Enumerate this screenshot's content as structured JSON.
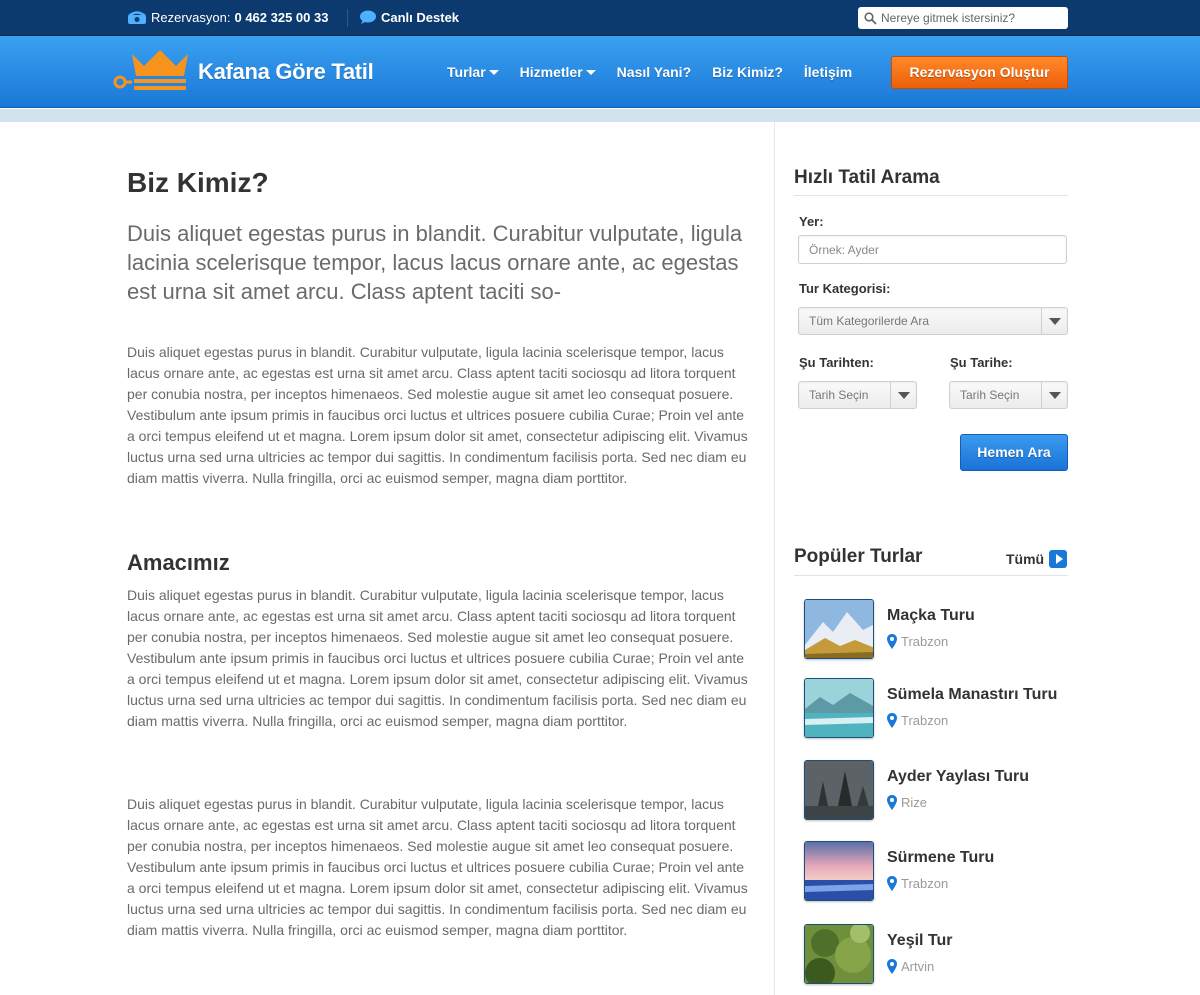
{
  "topbar": {
    "phone_label": "Rezervasyon:",
    "phone_number": "0 462 325 00 33",
    "support_label": "Canlı Destek",
    "search_placeholder": "Nereye gitmek istersiniz?"
  },
  "header": {
    "logo_text": "Kafana Göre Tatil",
    "nav": [
      {
        "label": "Turlar",
        "dropdown": true
      },
      {
        "label": "Hizmetler",
        "dropdown": true
      },
      {
        "label": "Nasıl Yani?",
        "dropdown": false
      },
      {
        "label": "Biz Kimiz?",
        "dropdown": false
      },
      {
        "label": "İletişim",
        "dropdown": false
      }
    ],
    "cta_label": "Rezervasyon Oluştur"
  },
  "main": {
    "title": "Biz Kimiz?",
    "lead": "Duis aliquet egestas purus in blandit. Curabitur vulputate, ligula lacinia scelerisque tempor, lacus lacus ornare ante, ac egestas est urna sit amet arcu. Class aptent taciti so-",
    "para1": "Duis aliquet egestas purus in blandit. Curabitur vulputate, ligula lacinia scelerisque tempor, lacus lacus ornare ante, ac egestas est urna sit amet arcu. Class aptent taciti sociosqu ad litora torquent per conubia nostra, per inceptos himenaeos. Sed molestie augue sit amet leo consequat posuere. Vestibulum ante ipsum primis in faucibus orci luctus et ultrices posuere cubilia Curae; Proin vel ante a orci tempus eleifend ut et magna. Lorem ipsum dolor sit amet, consectetur adipiscing elit. Vivamus luctus urna sed urna ultricies ac tempor dui sagittis. In condimentum facilisis porta. Sed nec diam eu diam mattis viverra. Nulla fringilla, orci ac euismod semper, magna diam porttitor.",
    "section_title": "Amacımız",
    "para2": "Duis aliquet egestas purus in blandit. Curabitur vulputate, ligula lacinia scelerisque tempor, lacus lacus ornare ante, ac egestas est urna sit amet arcu. Class aptent taciti sociosqu ad litora torquent per conubia nostra, per inceptos himenaeos. Sed molestie augue sit amet leo consequat posuere. Vestibulum ante ipsum primis in faucibus orci luctus et ultrices posuere cubilia Curae; Proin vel ante a orci tempus eleifend ut et magna. Lorem ipsum dolor sit amet, consectetur adipiscing elit. Vivamus luctus urna sed urna ultricies ac tempor dui sagittis. In condimentum facilisis porta. Sed nec diam eu diam mattis viverra. Nulla fringilla, orci ac euismod semper, magna diam porttitor.",
    "para3": "Duis aliquet egestas purus in blandit. Curabitur vulputate, ligula lacinia scelerisque tempor, lacus lacus ornare ante, ac egestas est urna sit amet arcu. Class aptent taciti sociosqu ad litora torquent per conubia nostra, per inceptos himenaeos. Sed molestie augue sit amet leo consequat posuere. Vestibulum ante ipsum primis in faucibus orci luctus et ultrices posuere cubilia Curae; Proin vel ante a orci tempus eleifend ut et magna. Lorem ipsum dolor sit amet, consectetur adipiscing elit. Vivamus luctus urna sed urna ultricies ac tempor dui sagittis. In condimentum facilisis porta. Sed nec diam eu diam mattis viverra. Nulla fringilla, orci ac euismod semper, magna diam porttitor."
  },
  "search_form": {
    "title": "Hızlı Tatil Arama",
    "place_label": "Yer:",
    "place_placeholder": "Örnek: Ayder",
    "category_label": "Tur Kategorisi:",
    "category_value": "Tüm Kategorilerde Ara",
    "from_label": "Şu Tarihten:",
    "from_value": "Tarih Seçin",
    "to_label": "Şu Tarihe:",
    "to_value": "Tarih Seçin",
    "submit_label": "Hemen Ara"
  },
  "popular": {
    "title": "Popüler Turlar",
    "all_label": "Tümü",
    "tours": [
      {
        "name": "Maçka Turu",
        "location": "Trabzon"
      },
      {
        "name": "Sümela Manastırı Turu",
        "location": "Trabzon"
      },
      {
        "name": "Ayder Yaylası Turu",
        "location": "Rize"
      },
      {
        "name": "Sürmene Turu",
        "location": "Trabzon"
      },
      {
        "name": "Yeşil Tur",
        "location": "Artvin"
      }
    ]
  },
  "colors": {
    "brand_blue": "#1a78d8",
    "cta_orange": "#ee5e0b",
    "topbar_navy": "#0d3a6e"
  }
}
